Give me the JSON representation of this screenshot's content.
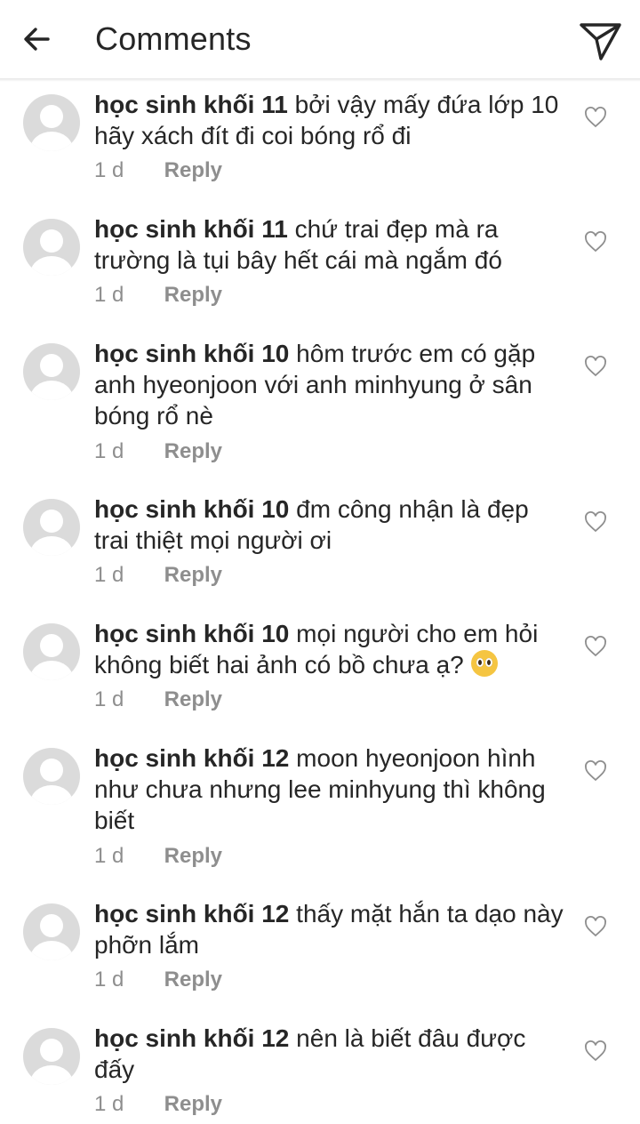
{
  "header": {
    "title": "Comments",
    "back_icon": "arrow-left-icon",
    "send_icon": "paper-plane-icon"
  },
  "comments": [
    {
      "username": "học sinh khối 11",
      "text": "bởi vậy mấy đứa lớp 10 hãy xách đít đi coi bóng rổ đi",
      "time": "1 d",
      "reply": "Reply"
    },
    {
      "username": "học sinh khối 11",
      "text": "chứ trai đẹp mà ra trường là tụi bây hết cái mà ngắm đó",
      "time": "1 d",
      "reply": "Reply"
    },
    {
      "username": "học sinh khối 10",
      "text": "hôm trước em có gặp anh hyeonjoon với anh minhyung ở sân bóng rổ nè",
      "time": "1 d",
      "reply": "Reply"
    },
    {
      "username": "học sinh khối 10",
      "text": "đm công nhận là đẹp trai thiệt mọi người ơi",
      "time": "1 d",
      "reply": "Reply"
    },
    {
      "username": "học sinh khối 10",
      "text": "mọi người cho em hỏi không biết hai ảnh có bồ chưa ạ?",
      "emoji": "pleading-face-emoji",
      "time": "1 d",
      "reply": "Reply"
    },
    {
      "username": "học sinh khối 12",
      "text": "moon hyeonjoon hình như chưa nhưng lee minhyung thì không biết",
      "time": "1 d",
      "reply": "Reply"
    },
    {
      "username": "học sinh khối 12",
      "text": "thấy mặt hắn ta dạo này phỡn lắm",
      "time": "1 d",
      "reply": "Reply"
    },
    {
      "username": "học sinh khối 12",
      "text": "nên là biết đâu được đấy",
      "time": "1 d",
      "reply": "Reply"
    }
  ],
  "like_icon": "heart-outline-icon",
  "colors": {
    "text": "#262626",
    "meta": "#8e8e8e",
    "avatar": "#dbdbdb"
  }
}
